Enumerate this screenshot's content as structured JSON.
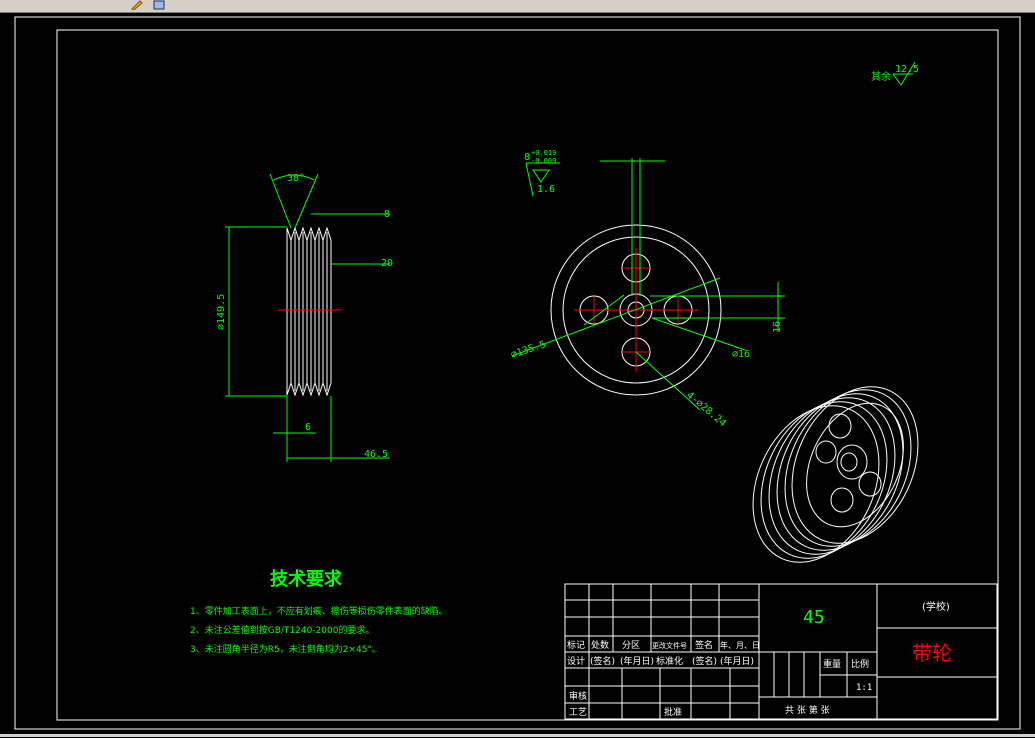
{
  "toolbar": {
    "icons": [
      "draw-icon",
      "view-icon"
    ]
  },
  "drawing": {
    "roughness": {
      "label": "其余",
      "value": "12.5"
    },
    "side_view": {
      "angle": "38°",
      "groove_top": "8",
      "groove_width": "20",
      "diameter": "⌀149.5",
      "hub_offset": "6",
      "total_width": "46.5"
    },
    "front_view": {
      "keyway": "8",
      "tol_upper": "+0.019",
      "tol_lower": "-0.009",
      "surface": "1.6",
      "key_height": "16",
      "outer_dia": "⌀135.5",
      "bore_dia": "⌀16",
      "holes": "4-⌀28.24"
    },
    "tech_req": {
      "title": "技术要求",
      "items": [
        "1、零件加工表面上，不应有划痕、擦伤等损伤零件表面的缺陷。",
        "2、未注公差值到按GB/T1240-2000的要求。",
        "3、未注圆角半径为R5，未注倒角均为2×45°。"
      ]
    },
    "title_block": {
      "material": "45",
      "school": "(学校)",
      "part_name": "带轮",
      "row_marks": [
        "标记",
        "处数",
        "分区",
        "更改文件号",
        "签名",
        "年、月、日"
      ],
      "row_design": [
        "设计",
        "(签名)",
        "(年月日)",
        "标准化",
        "(签名)",
        "(年月日)"
      ],
      "review": "审核",
      "process": "工艺",
      "approve": "批准",
      "weight": "重量",
      "scale": "比例",
      "scale_value": "1:1",
      "sheets": "共  张  第  张"
    }
  }
}
